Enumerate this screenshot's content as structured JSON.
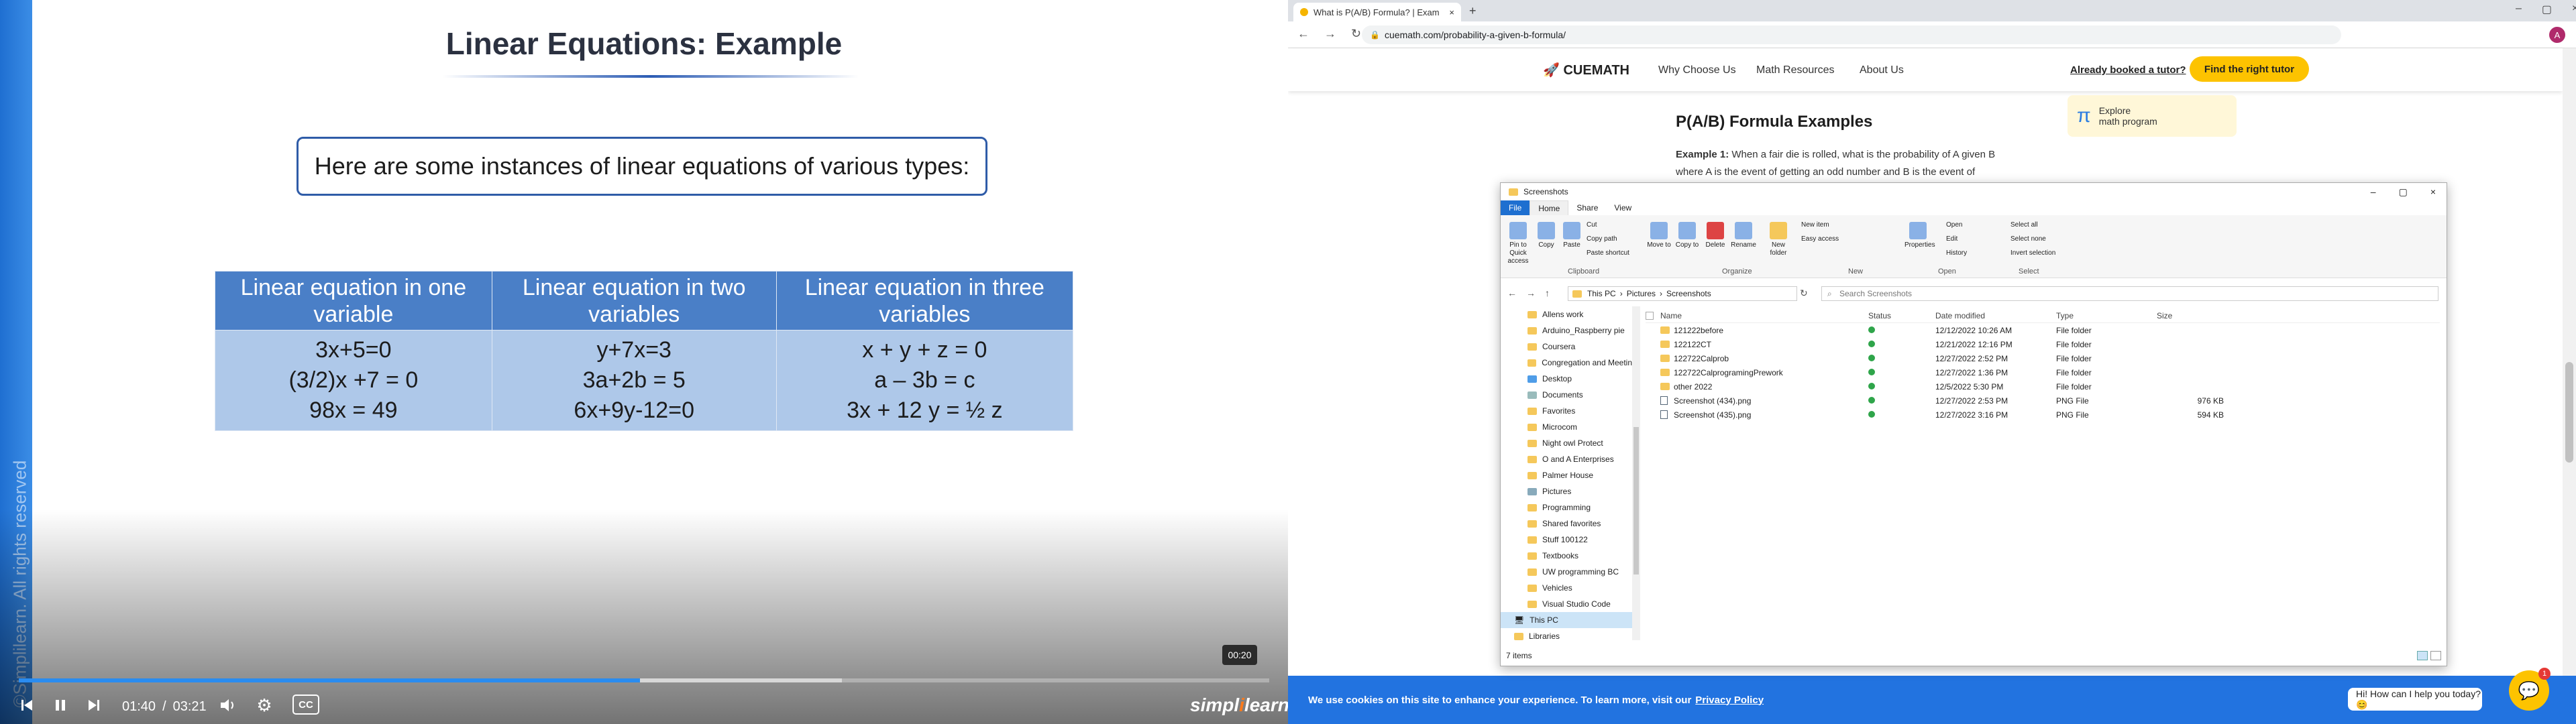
{
  "video": {
    "slide_title": "Linear Equations: Example",
    "intro": "Here are some instances of linear equations of various types:",
    "columns": [
      "Linear equation in one variable",
      "Linear equation in two variables",
      "Linear equation in three variables"
    ],
    "rows": [
      [
        "3x+5=0",
        "y+7x=3",
        "x + y + z = 0"
      ],
      [
        "(3/2)x +7 = 0",
        "3a+2b = 5",
        "a – 3b = c"
      ],
      [
        "98x = 49",
        "6x+9y-12=0",
        "3x + 12 y = ½ z"
      ]
    ],
    "watermark": "©Simplilearn. All rights reserved",
    "current_time": "01:40",
    "separator": "/",
    "duration": "03:21",
    "hover_time": "00:20",
    "progress": 0.497,
    "buffered": 0.658,
    "cc_label": "CC",
    "brand_a": "simpl",
    "brand_b": "i",
    "brand_c": "learn",
    "accent": "#2a8cf0"
  },
  "browser": {
    "tab_title": "What is P(A/B) Formula? | Exam",
    "url": "cuemath.com/probability-a-given-b-formula/",
    "site": {
      "logo": "CUEMATH",
      "nav": [
        "Why Choose Us",
        "Math Resources",
        "About Us"
      ],
      "booked": "Already booked a tutor?",
      "cta": "Find the right tutor",
      "card_line1": "Explore",
      "card_line2": "math program",
      "heading": "P(A/B) Formula Examples",
      "example_label": "Example 1:",
      "example_text": "When a fair die is rolled, what is the probability of A given B where A is the event of getting an odd number and B is the event of",
      "cookie_text": "We use cookies on this site to enhance your experience. To learn more, visit our",
      "cookie_link": "Privacy Policy",
      "chat_text": "Hi! How can I help you today? 😊",
      "chat_badge": "1",
      "cta_color": "#fdc300"
    }
  },
  "explorer": {
    "title": "Screenshots",
    "ribbon_tabs": [
      "File",
      "Home",
      "Share",
      "View"
    ],
    "ribbon": {
      "pin": "Pin to Quick access",
      "copy": "Copy",
      "paste": "Paste",
      "cut": "Cut",
      "copy_path": "Copy path",
      "paste_shortcut": "Paste shortcut",
      "move_to": "Move to",
      "copy_to": "Copy to",
      "delete": "Delete",
      "rename": "Rename",
      "new_folder": "New folder",
      "new_item": "New item",
      "easy_access": "Easy access",
      "properties": "Properties",
      "open": "Open",
      "edit": "Edit",
      "history": "History",
      "select_all": "Select all",
      "select_none": "Select none",
      "invert_selection": "Invert selection",
      "groups": [
        "Clipboard",
        "Organize",
        "New",
        "Open",
        "Select"
      ]
    },
    "breadcrumb": [
      "This PC",
      "Pictures",
      "Screenshots"
    ],
    "search_placeholder": "Search Screenshots",
    "nav": [
      "Allens work",
      "Arduino_Raspberry pie",
      "Coursera",
      "Congregation and Meetin",
      "Desktop",
      "Documents",
      "Favorites",
      "Microcom",
      "Night owl Protect",
      "O and A Enterprises",
      "Palmer House",
      "Pictures",
      "Programming",
      "Shared favorites",
      "Stuff 100122",
      "Textbooks",
      "UW programming BC",
      "Vehicles",
      "Visual Studio Code",
      "This PC",
      "Libraries"
    ],
    "columns": [
      "Name",
      "Status",
      "Date modified",
      "Type",
      "Size"
    ],
    "files": [
      {
        "name": "121222before",
        "date": "12/12/2022 10:26 AM",
        "type": "File folder",
        "size": ""
      },
      {
        "name": "122122CT",
        "date": "12/21/2022 12:16 PM",
        "type": "File folder",
        "size": ""
      },
      {
        "name": "122722Calprob",
        "date": "12/27/2022 2:52 PM",
        "type": "File folder",
        "size": ""
      },
      {
        "name": "122722CalprogramingPrework",
        "date": "12/27/2022 1:36 PM",
        "type": "File folder",
        "size": ""
      },
      {
        "name": "other 2022",
        "date": "12/5/2022 5:30 PM",
        "type": "File folder",
        "size": ""
      },
      {
        "name": "Screenshot (434).png",
        "date": "12/27/2022 2:53 PM",
        "type": "PNG File",
        "size": "976 KB"
      },
      {
        "name": "Screenshot (435).png",
        "date": "12/27/2022 3:16 PM",
        "type": "PNG File",
        "size": "594 KB"
      }
    ],
    "status": "7 items"
  }
}
